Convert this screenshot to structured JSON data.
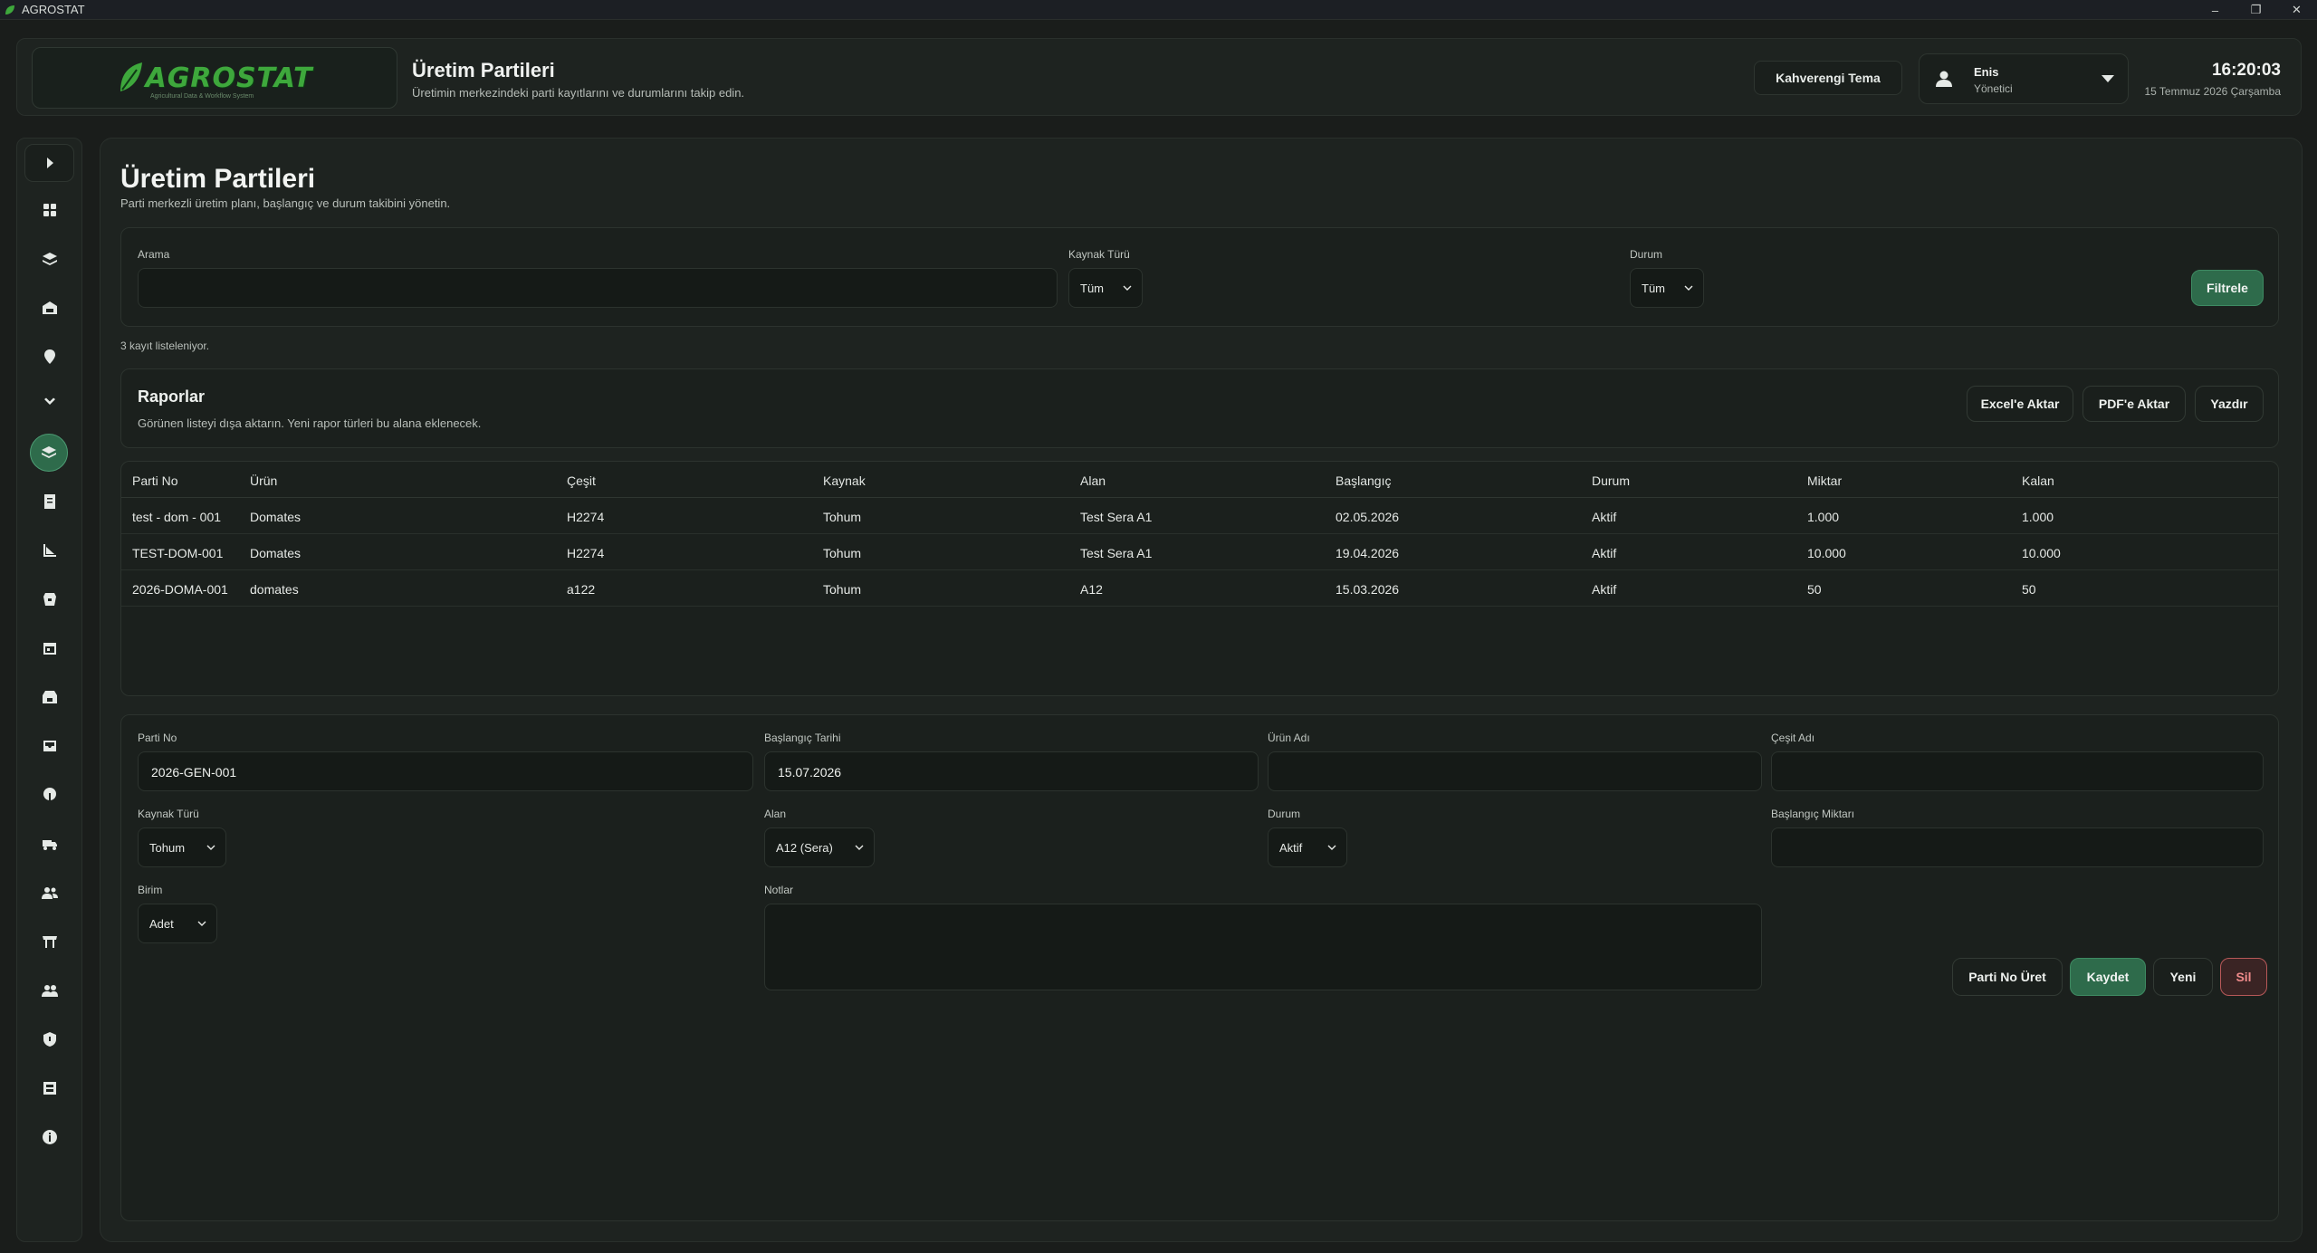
{
  "window": {
    "title": "AGROSTAT",
    "min": "–",
    "max": "❐",
    "close": "✕"
  },
  "header": {
    "logo_text": "AGROSTAT",
    "logo_tagline": "Agricultural Data & Workflow System",
    "title": "Üretim Partileri",
    "subtitle": "Üretimin merkezindeki parti kayıtlarını ve durumlarını takip edin.",
    "theme_button": "Kahverengi Tema",
    "user_name": "Enis",
    "user_role": "Yönetici",
    "time": "16:20:03",
    "date": "15 Temmuz 2026 Çarşamba"
  },
  "sidebar": {
    "items": [
      {
        "name": "sidebar-toggle",
        "icon": "chevron-right-icon"
      },
      {
        "name": "sidebar-item-dashboard",
        "icon": "grid-icon"
      },
      {
        "name": "sidebar-item-layers",
        "icon": "layers-icon"
      },
      {
        "name": "sidebar-item-warehouse",
        "icon": "warehouse-icon"
      },
      {
        "name": "sidebar-item-location",
        "icon": "location-pin-icon"
      },
      {
        "name": "sidebar-item-expand",
        "icon": "chevron-down-icon"
      },
      {
        "name": "sidebar-item-production-batches",
        "icon": "stack-icon",
        "active": true
      },
      {
        "name": "sidebar-item-documents",
        "icon": "document-icon"
      },
      {
        "name": "sidebar-item-charts",
        "icon": "chart-icon"
      },
      {
        "name": "sidebar-item-storage",
        "icon": "barrel-icon"
      },
      {
        "name": "sidebar-item-calendar",
        "icon": "calendar-icon"
      },
      {
        "name": "sidebar-item-store",
        "icon": "store-icon"
      },
      {
        "name": "sidebar-item-inbox",
        "icon": "inbox-icon"
      },
      {
        "name": "sidebar-item-plant",
        "icon": "sprout-icon"
      },
      {
        "name": "sidebar-item-vehicle",
        "icon": "truck-icon"
      },
      {
        "name": "sidebar-item-people",
        "icon": "people-icon"
      },
      {
        "name": "sidebar-item-cart",
        "icon": "cart-icon"
      },
      {
        "name": "sidebar-item-team",
        "icon": "team-icon"
      },
      {
        "name": "sidebar-item-security",
        "icon": "shield-icon"
      },
      {
        "name": "sidebar-item-archive",
        "icon": "archive-icon"
      },
      {
        "name": "sidebar-item-info",
        "icon": "info-icon"
      }
    ]
  },
  "main": {
    "title": "Üretim Partileri",
    "subtitle": "Parti merkezli üretim planı, başlangıç ve durum takibini yönetin."
  },
  "filters": {
    "search_label": "Arama",
    "search_value": "",
    "source_label": "Kaynak Türü",
    "source_value": "Tüm",
    "status_label": "Durum",
    "status_value": "Tüm",
    "filter_button": "Filtrele",
    "count_text": "3 kayıt listeleniyor."
  },
  "reports": {
    "title": "Raporlar",
    "subtitle": "Görünen listeyi dışa aktarın. Yeni rapor türleri bu alana eklenecek.",
    "excel_button": "Excel'e Aktar",
    "pdf_button": "PDF'e Aktar",
    "print_button": "Yazdır"
  },
  "table": {
    "columns": [
      "Parti No",
      "Ürün",
      "Çeşit",
      "Kaynak",
      "Alan",
      "Başlangıç",
      "Durum",
      "Miktar",
      "Kalan"
    ],
    "rows": [
      [
        "test - dom - 001",
        "Domates",
        "H2274",
        "Tohum",
        "Test Sera A1",
        "02.05.2026",
        "Aktif",
        "1.000",
        "1.000"
      ],
      [
        "TEST-DOM-001",
        "Domates",
        "H2274",
        "Tohum",
        "Test Sera A1",
        "19.04.2026",
        "Aktif",
        "10.000",
        "10.000"
      ],
      [
        "2026-DOMA-001",
        "domates",
        "a122",
        "Tohum",
        "A12",
        "15.03.2026",
        "Aktif",
        "50",
        "50"
      ]
    ]
  },
  "form": {
    "batch_no_label": "Parti No",
    "batch_no_value": "2026-GEN-001",
    "start_date_label": "Başlangıç Tarihi",
    "start_date_value": "15.07.2026",
    "product_label": "Ürün Adı",
    "product_value": "",
    "variety_label": "Çeşit Adı",
    "variety_value": "",
    "source_label": "Kaynak Türü",
    "source_value": "Tohum",
    "area_label": "Alan",
    "area_value": "A12 (Sera)",
    "status_label": "Durum",
    "status_value": "Aktif",
    "start_qty_label": "Başlangıç Miktarı",
    "start_qty_value": "",
    "unit_label": "Birim",
    "unit_value": "Adet",
    "notes_label": "Notlar",
    "notes_value": "",
    "generate_button": "Parti No Üret",
    "save_button": "Kaydet",
    "new_button": "Yeni",
    "delete_button": "Sil"
  },
  "colors": {
    "background": "#1a1d1b",
    "panel": "#1e2320",
    "accent": "#2e6b4b",
    "danger": "#ee8a8a",
    "logo": "#3ea83c"
  }
}
